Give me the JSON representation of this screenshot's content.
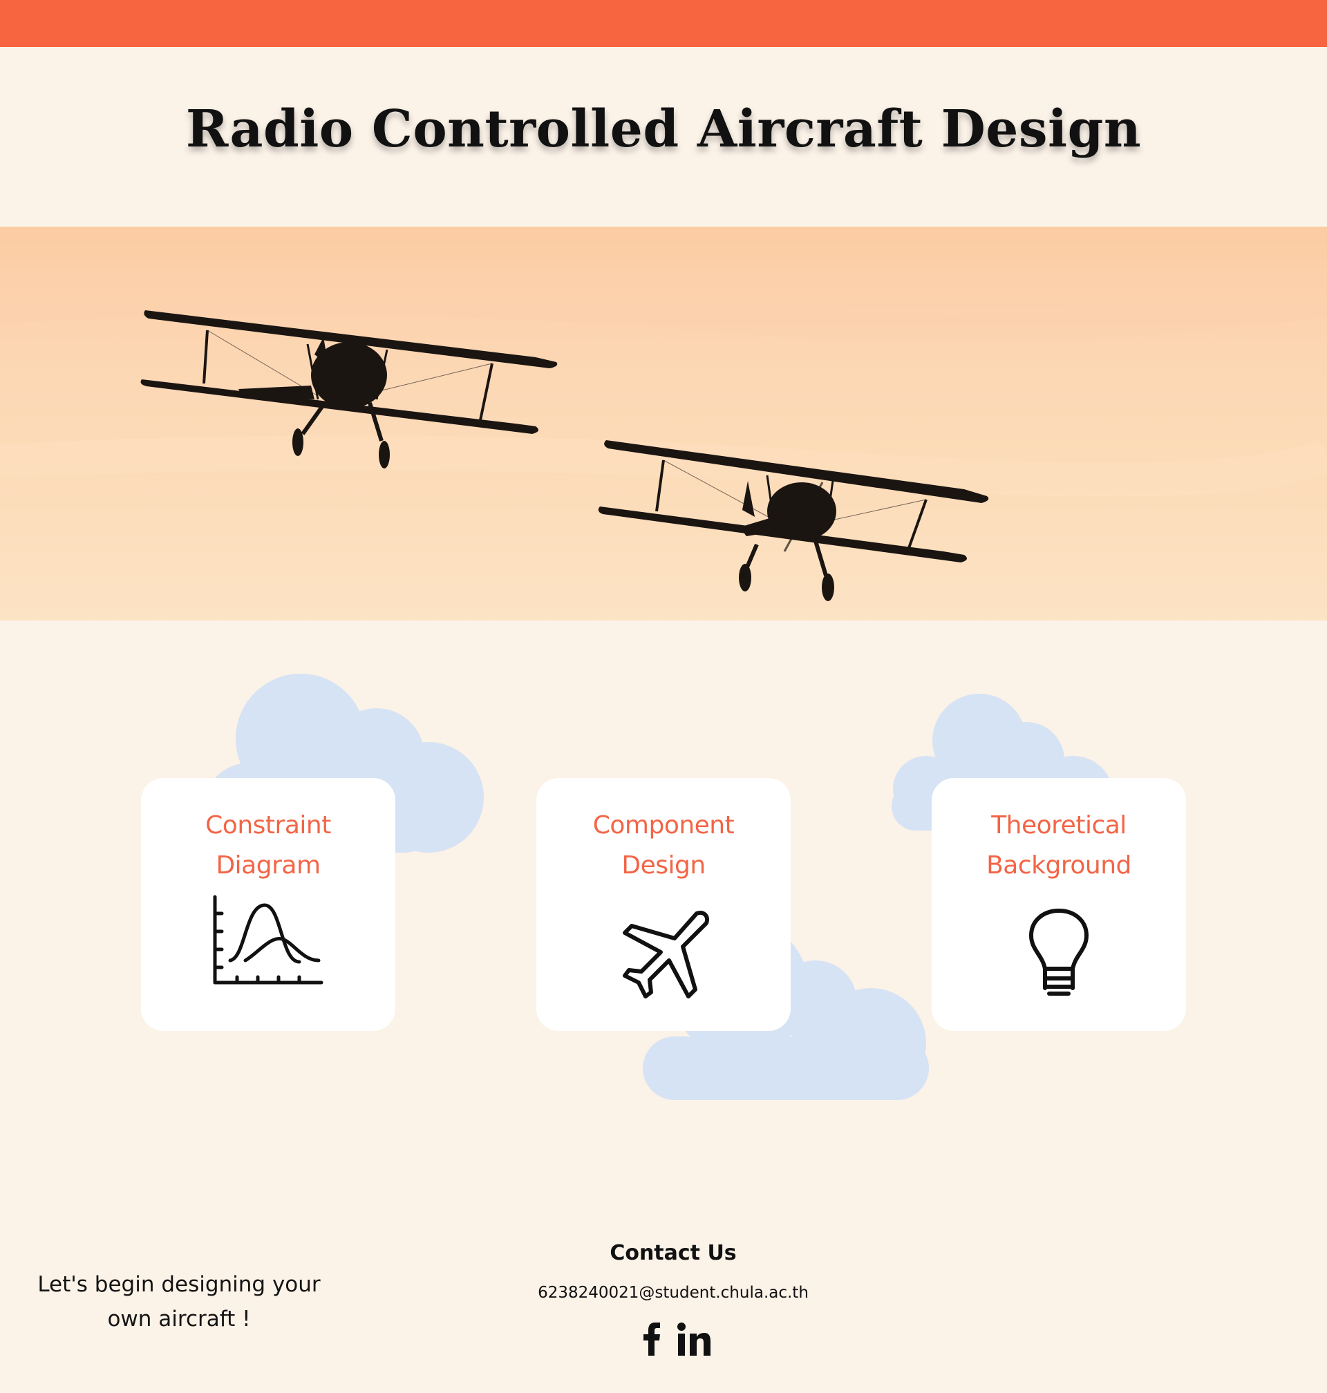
{
  "header": {
    "title": "Radio Controlled Aircraft Design"
  },
  "hero": {
    "image": "biplanes-in-sunset-sky"
  },
  "cards": [
    {
      "label": "Constraint\nDiagram",
      "icon": "chart-icon"
    },
    {
      "label": "Component\nDesign",
      "icon": "airplane-icon"
    },
    {
      "label": "Theoretical\nBackground",
      "icon": "lightbulb-icon"
    }
  ],
  "footer": {
    "tagline": "Let's begin designing your\nown aircraft !",
    "contact_title": "Contact Us",
    "email": "6238240021@student.chula.ac.th",
    "social": [
      "facebook-icon",
      "linkedin-icon"
    ]
  },
  "colors": {
    "accent": "#f76540",
    "background": "#fbf2e8",
    "card_label": "#f26546",
    "cloud": "#d6e3f4"
  }
}
